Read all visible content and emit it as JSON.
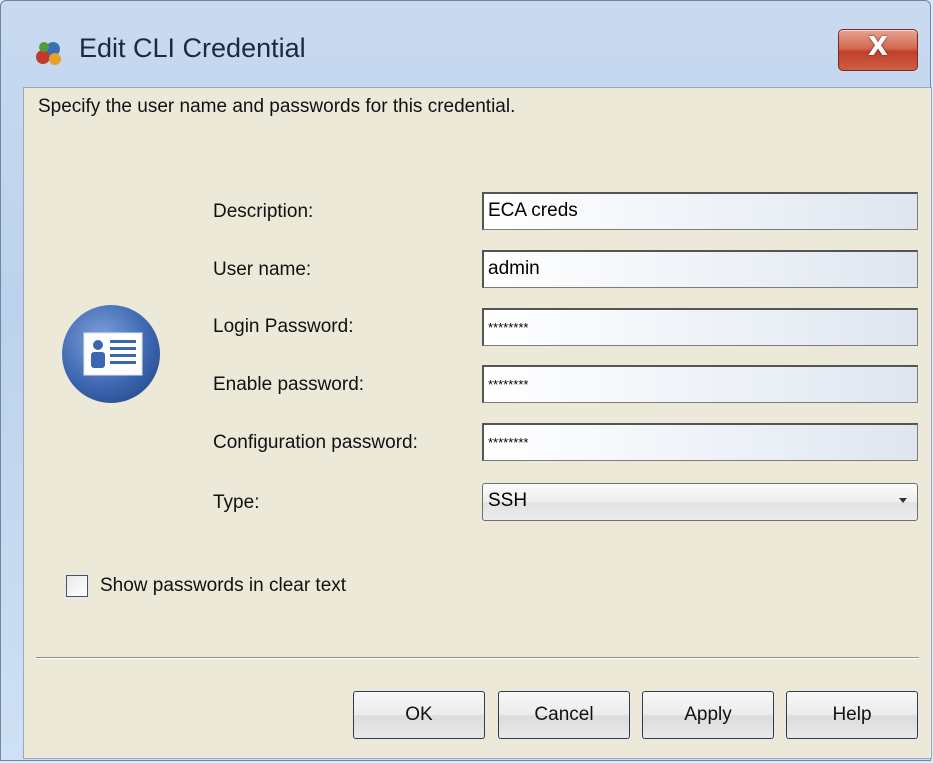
{
  "window": {
    "title": "Edit CLI Credential",
    "close_label": "X"
  },
  "dialog": {
    "instruction": "Specify the user name and passwords for this credential.",
    "fields": [
      {
        "label": "Description:",
        "value": "ECA creds"
      },
      {
        "label": "User name:",
        "value": "admin"
      },
      {
        "label": "Login Password:",
        "value": "********"
      },
      {
        "label": "Enable password:",
        "value": "********"
      },
      {
        "label": "Configuration password:",
        "value": "********"
      }
    ],
    "type": {
      "label": "Type:",
      "selected": "SSH"
    },
    "show_passwords": {
      "label": "Show passwords in clear text",
      "checked": false
    },
    "buttons": {
      "ok": "OK",
      "cancel": "Cancel",
      "apply": "Apply",
      "help": "Help"
    }
  },
  "icons": [
    "app-icon",
    "close-icon",
    "credential-card-icon",
    "chevron-down-icon"
  ],
  "colors": {
    "client_bg": "#ece9d8",
    "title_bar": "#c9daf0",
    "close_button": "#c94a33",
    "card_icon": "#4a74b8"
  }
}
